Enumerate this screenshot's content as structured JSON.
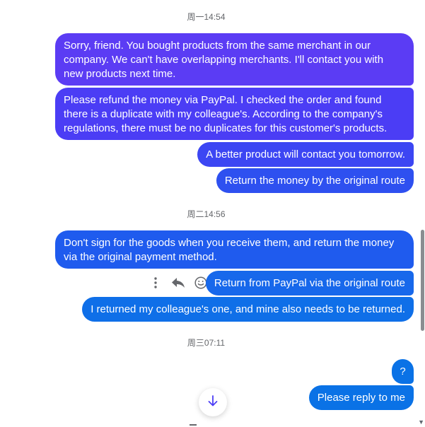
{
  "timestamps": [
    "周一14:54",
    "周二14:56",
    "周三07:11"
  ],
  "messages": [
    "Sorry, friend. You bought products from the same merchant in our company. We can't have overlapping merchants. I'll contact you with new products next time.",
    "Please refund the money via PayPal. I checked the order and found there is a duplicate with my colleague's. According to the company's regulations, there must be no duplicates for this customer's products.",
    "A better product will contact you tomorrow.",
    "Return the money by the original route",
    "Don't sign for the goods when you receive them, and return the money via the original payment method.",
    "Return from PayPal via the original route",
    "I returned my colleague's one, and mine also needs to be returned.",
    "?",
    "Please reply to me"
  ],
  "hover_actions": {
    "icons": [
      "more-options-icon",
      "reply-icon",
      "react-emoji-icon"
    ]
  },
  "scroll_button": {
    "icon": "arrow-down-icon"
  }
}
